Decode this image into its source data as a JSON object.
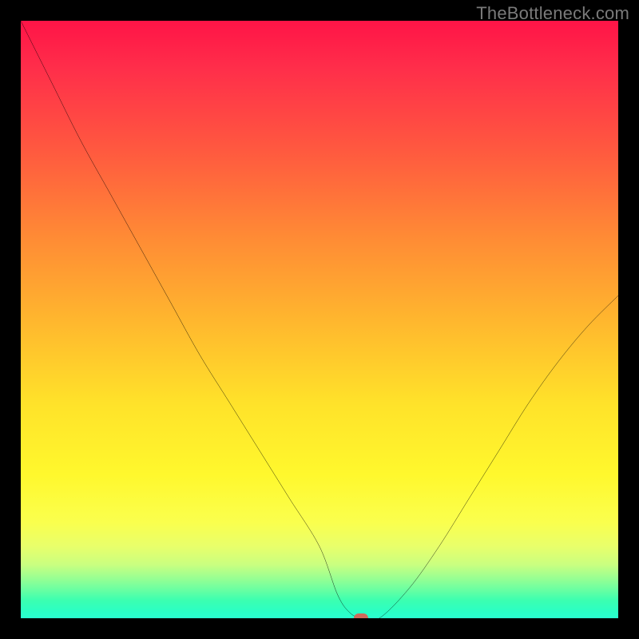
{
  "watermark": "TheBottleneck.com",
  "colors": {
    "frame": "#000000",
    "curve": "#000000",
    "marker": "#d06a5c",
    "gradient_stops": [
      "#ff1447",
      "#ff2e4a",
      "#ff5a3f",
      "#ff8a35",
      "#ffb62e",
      "#ffe22a",
      "#fff82d",
      "#faff4e",
      "#e8ff6b",
      "#caff80",
      "#9fff90",
      "#6fffa0",
      "#3bffb0",
      "#2affc6",
      "#2affd0"
    ]
  },
  "chart_data": {
    "type": "line",
    "title": "",
    "xlabel": "",
    "ylabel": "",
    "xlim": [
      0,
      100
    ],
    "ylim": [
      0,
      100
    ],
    "grid": false,
    "legend": false,
    "series": [
      {
        "name": "bottleneck-curve",
        "x": [
          0,
          5,
          10,
          15,
          20,
          25,
          30,
          35,
          40,
          45,
          50,
          53,
          55,
          57,
          60,
          65,
          70,
          75,
          80,
          85,
          90,
          95,
          100
        ],
        "y": [
          100,
          90,
          80,
          71,
          62,
          53,
          44,
          36,
          28,
          20,
          12,
          4,
          1,
          0,
          0,
          5,
          12,
          20,
          28,
          36,
          43,
          49,
          54
        ]
      }
    ],
    "annotations": [
      {
        "name": "min-marker",
        "x": 57,
        "y": 0,
        "shape": "rounded-rect",
        "color": "#d06a5c"
      }
    ],
    "background": {
      "type": "vertical-gradient-heat",
      "description": "red at top through orange, yellow, light-green to green at bottom"
    }
  }
}
